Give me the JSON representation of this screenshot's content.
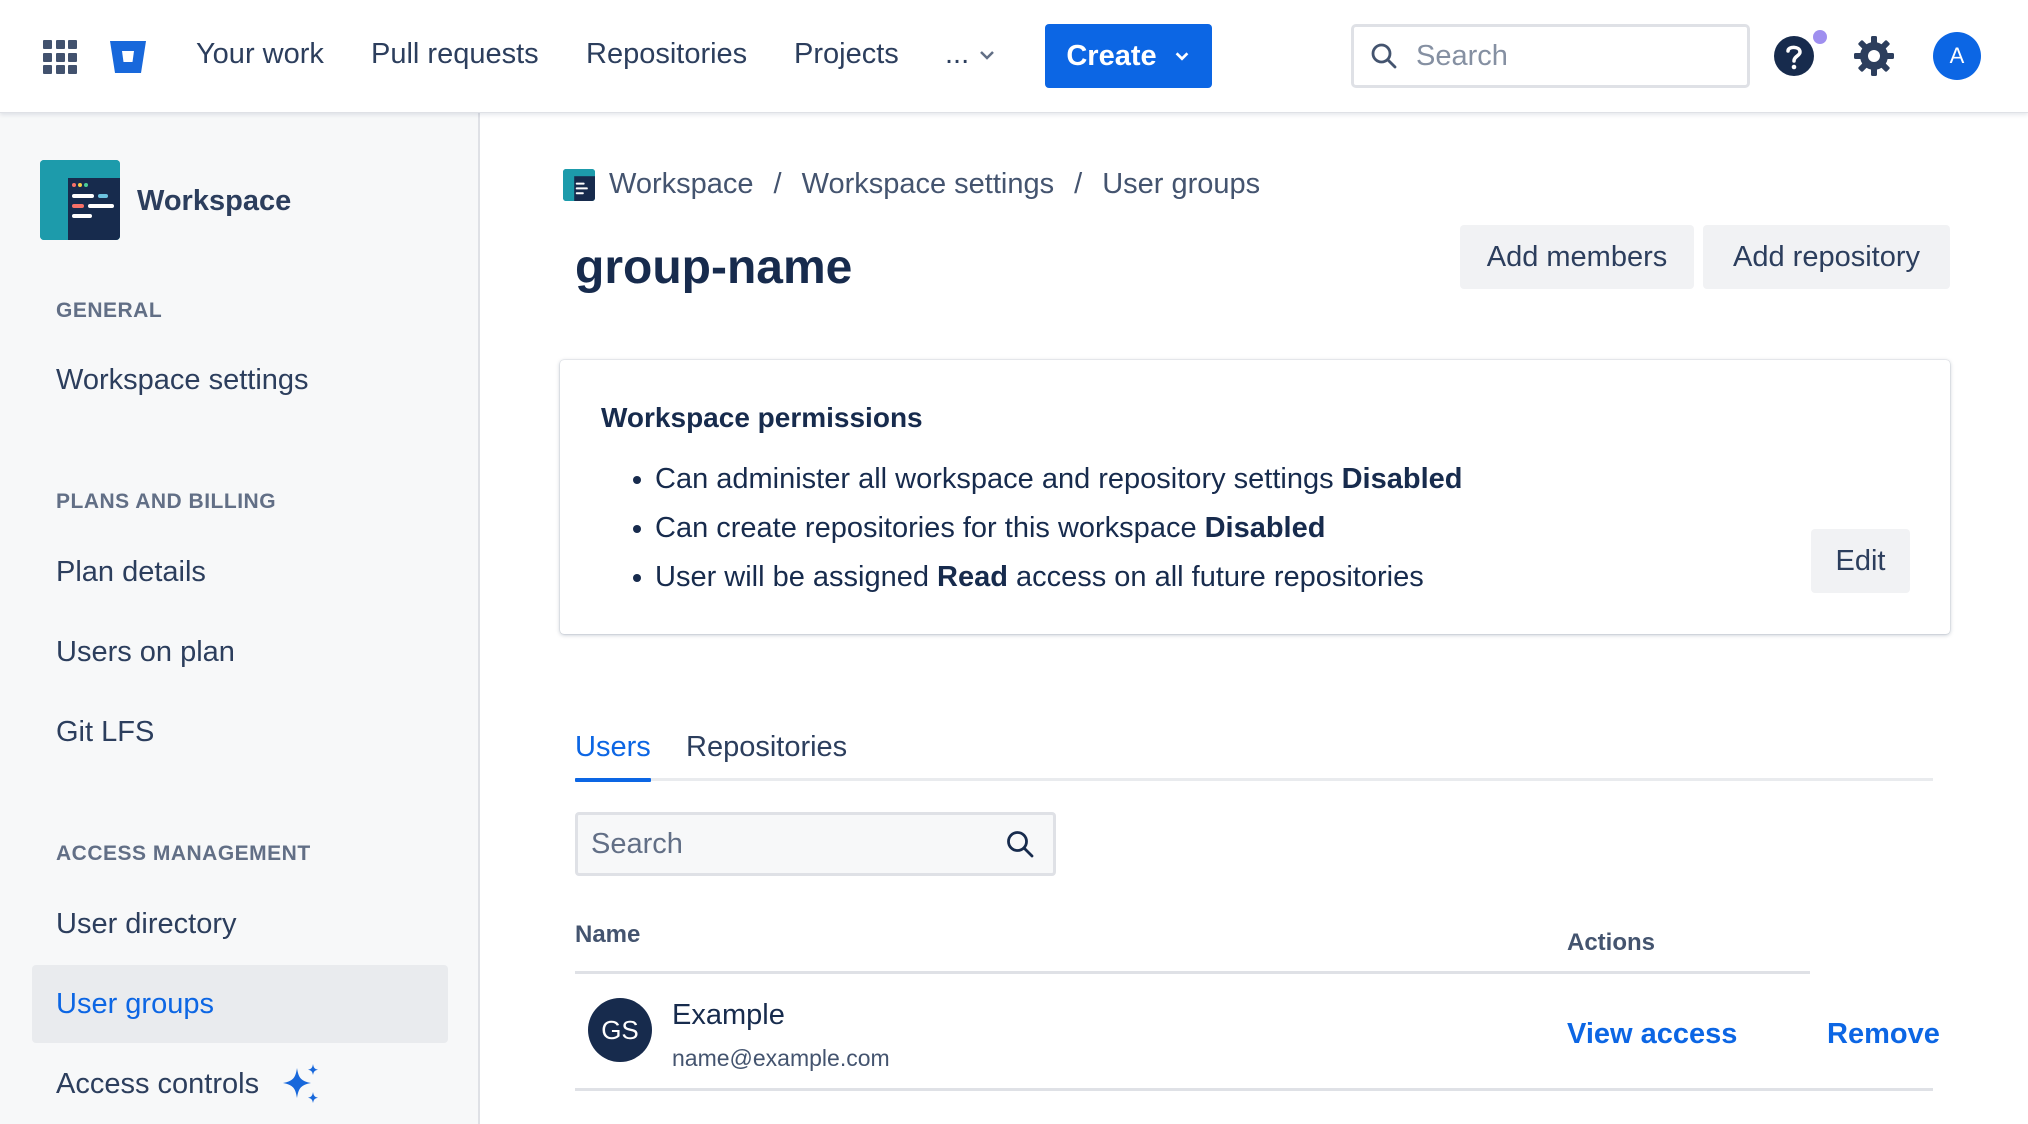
{
  "topnav": {
    "items": [
      "Your work",
      "Pull requests",
      "Repositories",
      "Projects"
    ],
    "more_label": "...",
    "create_label": "Create",
    "search_placeholder": "Search",
    "avatar_initial": "A",
    "brand_color": "#0c66e4",
    "help_dot_color": "#9f8fef"
  },
  "sidebar": {
    "workspace_name": "Workspace",
    "sections": [
      {
        "heading": "GENERAL",
        "items": [
          "Workspace settings"
        ]
      },
      {
        "heading": "PLANS AND BILLING",
        "items": [
          "Plan details",
          "Users on plan",
          "Git LFS"
        ]
      },
      {
        "heading": "ACCESS MANAGEMENT",
        "items": [
          "User directory",
          "User groups",
          "Access controls"
        ]
      }
    ],
    "active_item": "User groups"
  },
  "breadcrumb": [
    "Workspace",
    "Workspace settings",
    "User groups"
  ],
  "page": {
    "title": "group-name",
    "add_members_label": "Add members",
    "add_repository_label": "Add repository"
  },
  "permissions": {
    "title": "Workspace permissions",
    "items": [
      {
        "before": "Can administer all workspace and repository settings",
        "bold": "Disabled",
        "after": ""
      },
      {
        "before": "Can create repositories for this workspace",
        "bold": "Disabled",
        "after": ""
      },
      {
        "before": "User will be assigned",
        "bold": "Read",
        "after": "access on all future repositories"
      }
    ],
    "edit_label": "Edit"
  },
  "tabs": [
    {
      "label": "Users",
      "active": true
    },
    {
      "label": "Repositories",
      "active": false
    }
  ],
  "users": {
    "search_placeholder": "Search",
    "columns": {
      "name": "Name",
      "actions": "Actions"
    },
    "rows": [
      {
        "initials": "GS",
        "name": "Example",
        "email": "name@example.com",
        "view_label": "View access",
        "remove_label": "Remove"
      }
    ]
  }
}
